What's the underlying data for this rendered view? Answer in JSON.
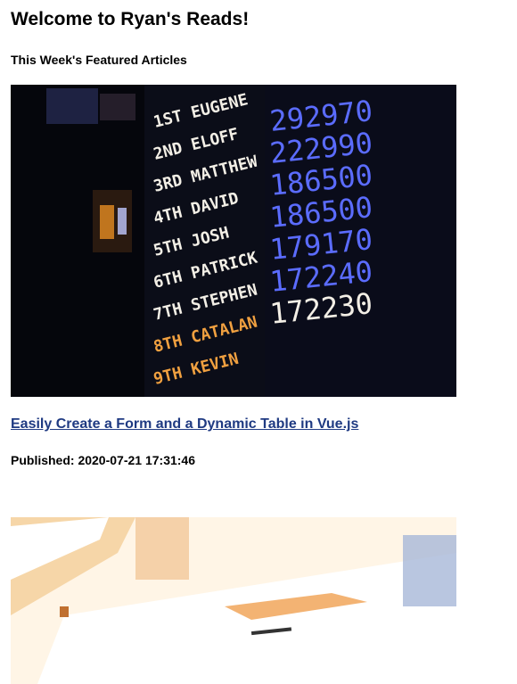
{
  "header": {
    "title": "Welcome to Ryan's Reads!"
  },
  "section": {
    "title": "This Week's Featured Articles"
  },
  "articles": [
    {
      "title": "Easily Create a Form and a Dynamic Table in Vue.js",
      "published_label": "Published:",
      "published_value": "2020-07-21 17:31:46",
      "image": {
        "kind": "photo-leaderboard",
        "rows": [
          {
            "rank": "1ST",
            "name": "EUGENE",
            "score": "292970"
          },
          {
            "rank": "2ND",
            "name": "ELOFF",
            "score": "222990"
          },
          {
            "rank": "3RD",
            "name": "MATTHEW",
            "score": "186500"
          },
          {
            "rank": "4TH",
            "name": "DAVID",
            "score": "186500"
          },
          {
            "rank": "5TH",
            "name": "JOSH",
            "score": "179170"
          },
          {
            "rank": "6TH",
            "name": "PATRICK",
            "score": "172240"
          },
          {
            "rank": "7TH",
            "name": "STEPHEN",
            "score": "172230"
          },
          {
            "rank": "8TH",
            "name": "CATALAN",
            "score": ""
          },
          {
            "rank": "9TH",
            "name": "KEVIN",
            "score": ""
          }
        ]
      }
    },
    {
      "image": {
        "kind": "photo-desk"
      }
    }
  ],
  "colors": {
    "link": "#1f3a82",
    "board_white": "#f3efe6",
    "board_blue": "#5b6cff",
    "board_orange": "#f0a040"
  }
}
